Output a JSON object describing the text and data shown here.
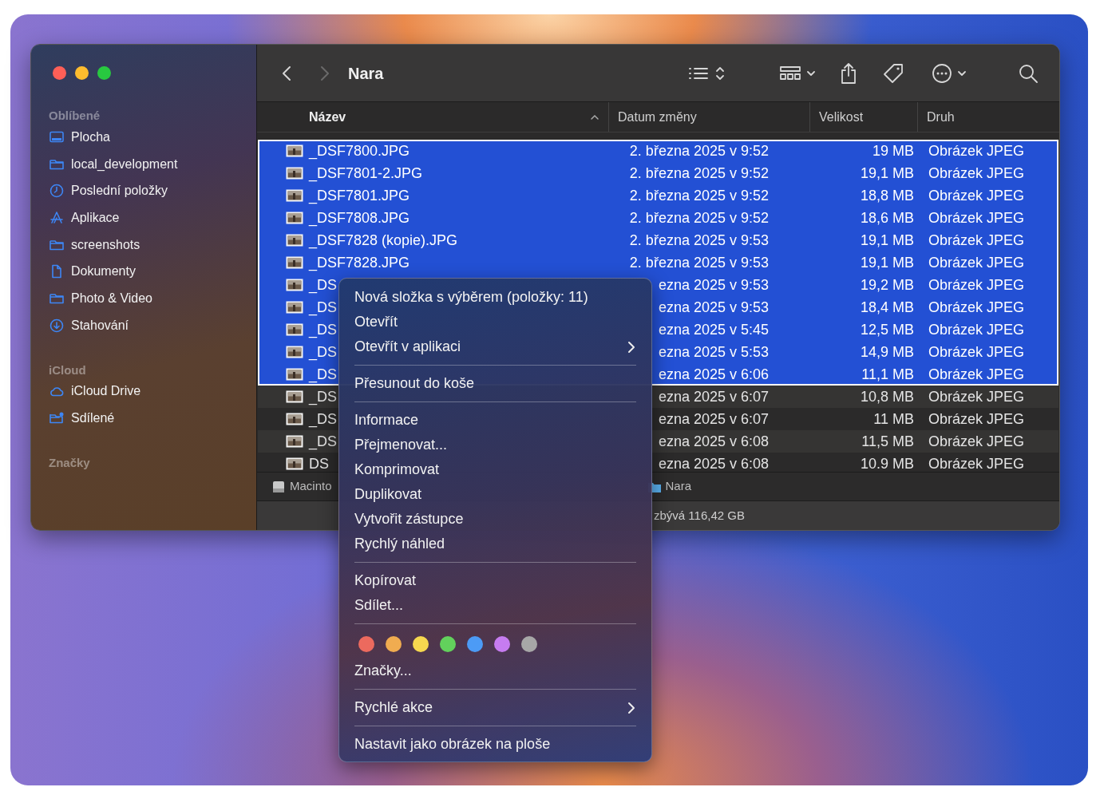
{
  "window": {
    "title": "Nara"
  },
  "navigation": {
    "back_enabled": true,
    "forward_enabled": false
  },
  "sidebar": {
    "sections": [
      {
        "title": "Oblíbené",
        "items": [
          {
            "kind": "desktop",
            "label": "Plocha"
          },
          {
            "kind": "folder",
            "label": "local_development"
          },
          {
            "kind": "clock",
            "label": "Poslední položky"
          },
          {
            "kind": "apps",
            "label": "Aplikace"
          },
          {
            "kind": "folder",
            "label": "screenshots"
          },
          {
            "kind": "document",
            "label": "Dokumenty"
          },
          {
            "kind": "folder",
            "label": "Photo & Video"
          },
          {
            "kind": "download",
            "label": "Stahování"
          }
        ]
      },
      {
        "title": "iCloud",
        "items": [
          {
            "kind": "cloud",
            "label": "iCloud Drive"
          },
          {
            "kind": "shared",
            "label": "Sdílené"
          }
        ]
      },
      {
        "title": "Značky"
      }
    ]
  },
  "table": {
    "columns": [
      {
        "label": "Název",
        "sorted": true
      },
      {
        "label": "Datum změny",
        "sorted": false
      },
      {
        "label": "Velikost",
        "sorted": false
      },
      {
        "label": "Druh",
        "sorted": false
      }
    ],
    "rows": [
      {
        "name": "_DSF7800.JPG",
        "date": "2. března 2025 v 9:52",
        "size": "19 MB",
        "kind": "Obrázek JPEG",
        "selected": true
      },
      {
        "name": "_DSF7801-2.JPG",
        "date": "2. března 2025 v 9:52",
        "size": "19,1 MB",
        "kind": "Obrázek JPEG",
        "selected": true
      },
      {
        "name": "_DSF7801.JPG",
        "date": "2. března 2025 v 9:52",
        "size": "18,8 MB",
        "kind": "Obrázek JPEG",
        "selected": true
      },
      {
        "name": "_DSF7808.JPG",
        "date": "2. března 2025 v 9:52",
        "size": "18,6 MB",
        "kind": "Obrázek JPEG",
        "selected": true
      },
      {
        "name": "_DSF7828 (kopie).JPG",
        "date": "2. března 2025 v 9:53",
        "size": "19,1 MB",
        "kind": "Obrázek JPEG",
        "selected": true
      },
      {
        "name": "_DSF7828.JPG",
        "date": "2. března 2025 v 9:53",
        "size": "19,1 MB",
        "kind": "Obrázek JPEG",
        "selected": true
      },
      {
        "name": "_DS",
        "date": "ezna 2025 v 9:53",
        "size": "19,2 MB",
        "kind": "Obrázek JPEG",
        "selected": true
      },
      {
        "name": "_DS",
        "date": "ezna 2025 v 9:53",
        "size": "18,4 MB",
        "kind": "Obrázek JPEG",
        "selected": true
      },
      {
        "name": "_DS",
        "date": "ezna 2025 v 5:45",
        "size": "12,5 MB",
        "kind": "Obrázek JPEG",
        "selected": true
      },
      {
        "name": "_DS",
        "date": "ezna 2025 v 5:53",
        "size": "14,9 MB",
        "kind": "Obrázek JPEG",
        "selected": true
      },
      {
        "name": "_DS",
        "date": "ezna 2025 v 6:06",
        "size": "11,1 MB",
        "kind": "Obrázek JPEG",
        "selected": true
      },
      {
        "name": "_DS",
        "date": "ezna 2025 v 6:07",
        "size": "10,8 MB",
        "kind": "Obrázek JPEG",
        "selected": false
      },
      {
        "name": "_DS",
        "date": "ezna 2025 v 6:07",
        "size": "11 MB",
        "kind": "Obrázek JPEG",
        "selected": false
      },
      {
        "name": "_DS",
        "date": "ezna 2025 v 6:08",
        "size": "11,5 MB",
        "kind": "Obrázek JPEG",
        "selected": false
      },
      {
        "name": "DS",
        "date": "ezna 2025 v 6:08",
        "size": "10.9 MB",
        "kind": "Obrázek JPEG",
        "selected": false
      }
    ]
  },
  "path_bar": [
    {
      "kind": "disk",
      "label": "Macinto"
    },
    {
      "kind": "folder",
      "label": "Nara"
    }
  ],
  "status_bar": "zbývá 116,42 GB",
  "context_menu": {
    "entries": [
      {
        "kind": "item",
        "label": "Nová složka s výběrem (položky: 11)",
        "submenu": false
      },
      {
        "kind": "item",
        "label": "Otevřít",
        "submenu": false
      },
      {
        "kind": "item",
        "label": "Otevřít v aplikaci",
        "submenu": true
      },
      {
        "kind": "separator"
      },
      {
        "kind": "item",
        "label": "Přesunout do koše",
        "submenu": false
      },
      {
        "kind": "separator"
      },
      {
        "kind": "item",
        "label": "Informace",
        "submenu": false
      },
      {
        "kind": "item",
        "label": "Přejmenovat...",
        "submenu": false
      },
      {
        "kind": "item",
        "label": "Komprimovat",
        "submenu": false
      },
      {
        "kind": "item",
        "label": "Duplikovat",
        "submenu": false
      },
      {
        "kind": "item",
        "label": "Vytvořit zástupce",
        "submenu": false
      },
      {
        "kind": "item",
        "label": "Rychlý náhled",
        "submenu": false
      },
      {
        "kind": "separator"
      },
      {
        "kind": "item",
        "label": "Kopírovat",
        "submenu": false
      },
      {
        "kind": "item",
        "label": "Sdílet...",
        "submenu": false
      },
      {
        "kind": "separator"
      },
      {
        "kind": "tags",
        "tags": [
          {
            "color": "#ec6a5e"
          },
          {
            "color": "#f0ac50"
          },
          {
            "color": "#f6d84f"
          },
          {
            "color": "#62d15c"
          },
          {
            "color": "#4c9bf6"
          },
          {
            "color": "#c67cf0"
          },
          {
            "color": "#a7a7a7"
          }
        ]
      },
      {
        "kind": "item",
        "label": "Značky...",
        "submenu": false
      },
      {
        "kind": "separator"
      },
      {
        "kind": "item",
        "label": "Rychlé akce",
        "submenu": true
      },
      {
        "kind": "separator"
      },
      {
        "kind": "item",
        "label": "Nastavit jako obrázek na ploše",
        "submenu": false
      }
    ]
  }
}
